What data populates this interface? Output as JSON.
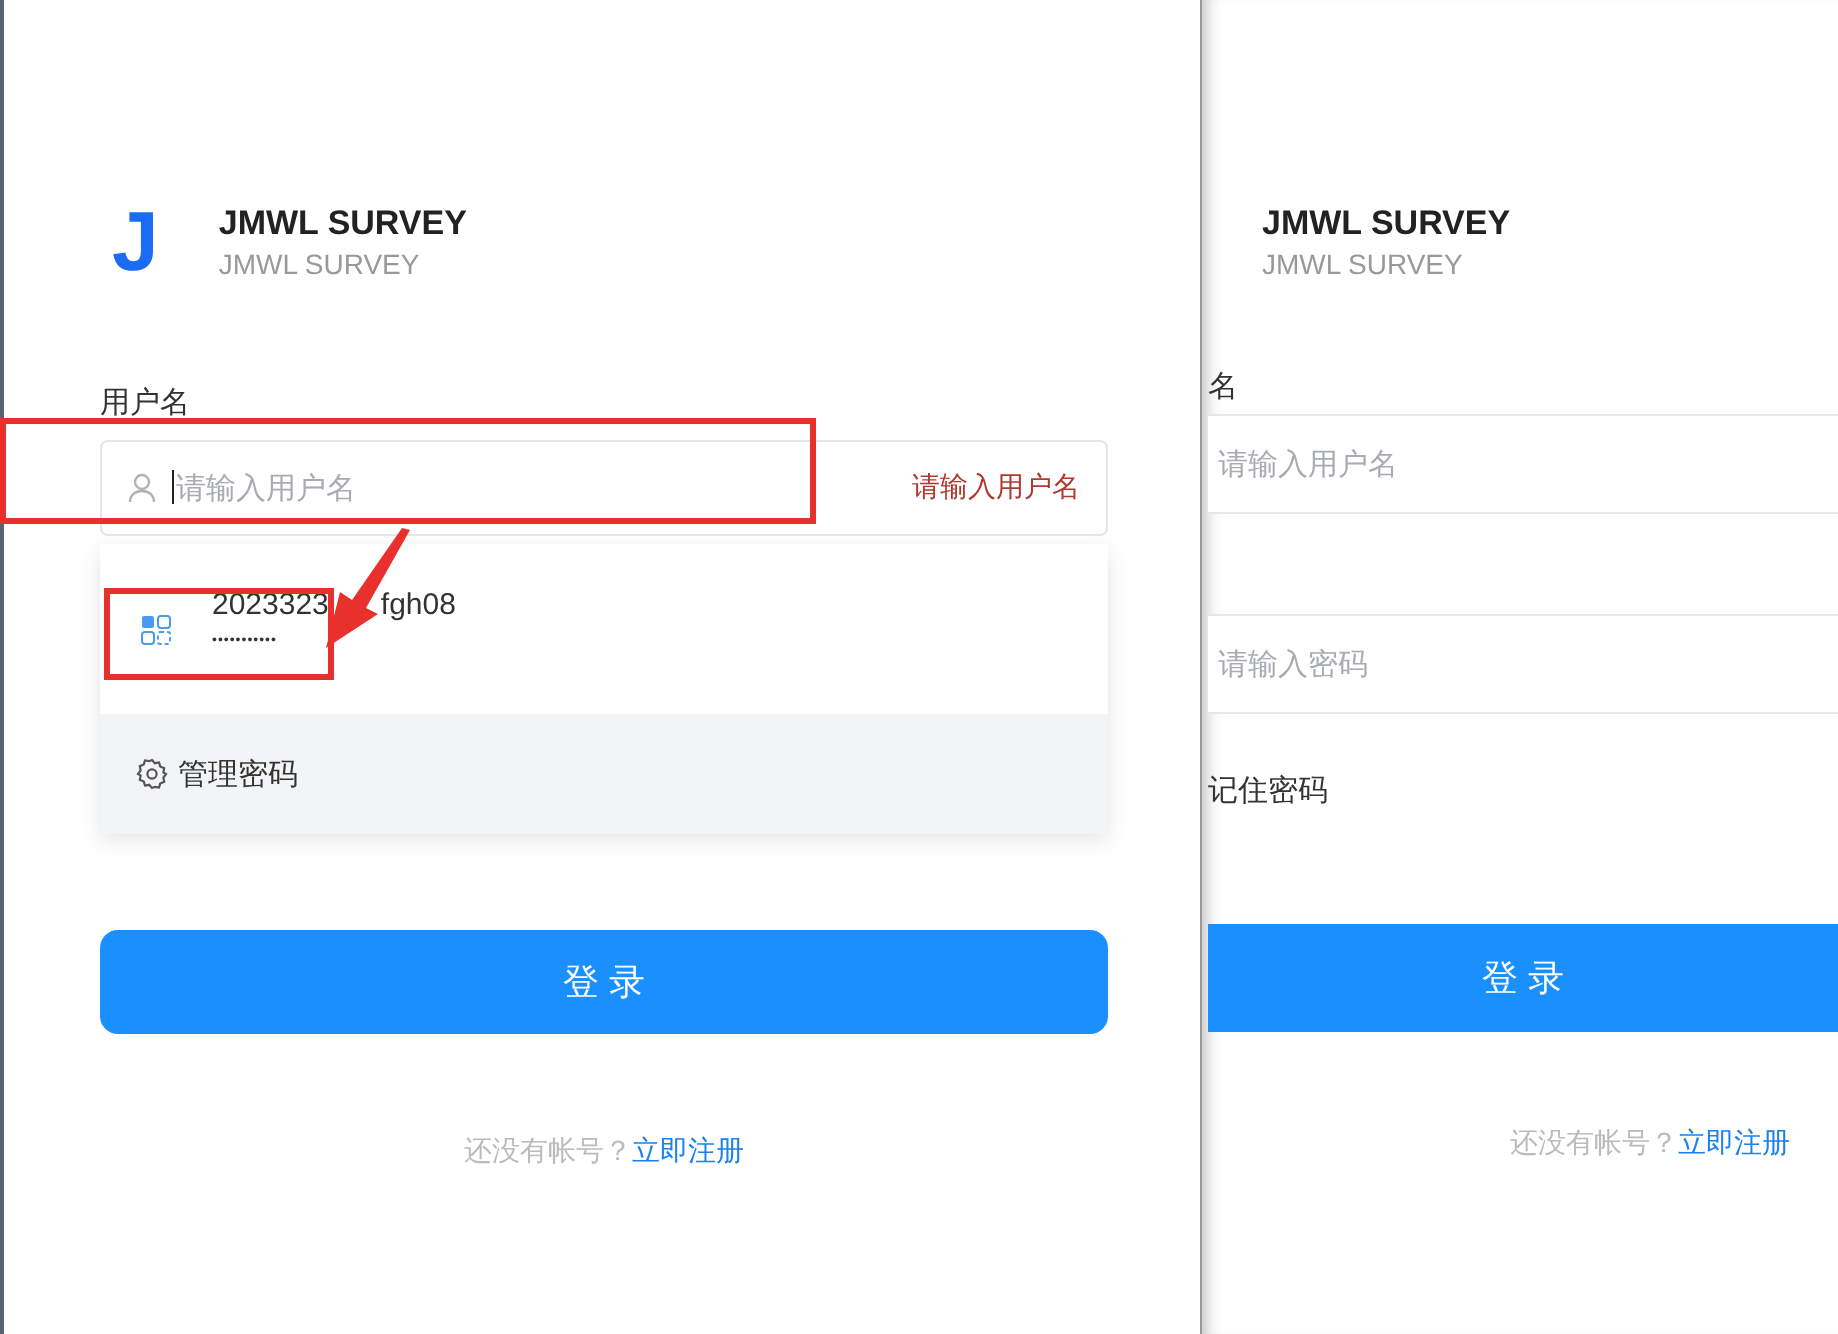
{
  "left_panel": {
    "brand": {
      "logo_letter": "J",
      "title": "JMWL SURVEY",
      "subtitle": "JMWL SURVEY"
    },
    "username": {
      "label": "用户名",
      "placeholder": "请输入用户名",
      "error": "请输入用户名"
    },
    "autofill": {
      "account_parts": [
        "2023323",
        "fgh08"
      ],
      "password_mask": "•••••••••••",
      "manage_label": "管理密码"
    },
    "login_button": "登 录",
    "signup": {
      "prompt": "还没有帐号？",
      "link": "立即注册"
    }
  },
  "right_panel": {
    "brand": {
      "title": "JMWL SURVEY",
      "subtitle": "JMWL SURVEY"
    },
    "username": {
      "label": "名",
      "placeholder": "请输入用户名"
    },
    "password": {
      "placeholder": "请输入密码"
    },
    "remember_label": "记住密码",
    "login_button": "登 录",
    "signup": {
      "prompt": "还没有帐号？",
      "link": "立即注册"
    }
  }
}
